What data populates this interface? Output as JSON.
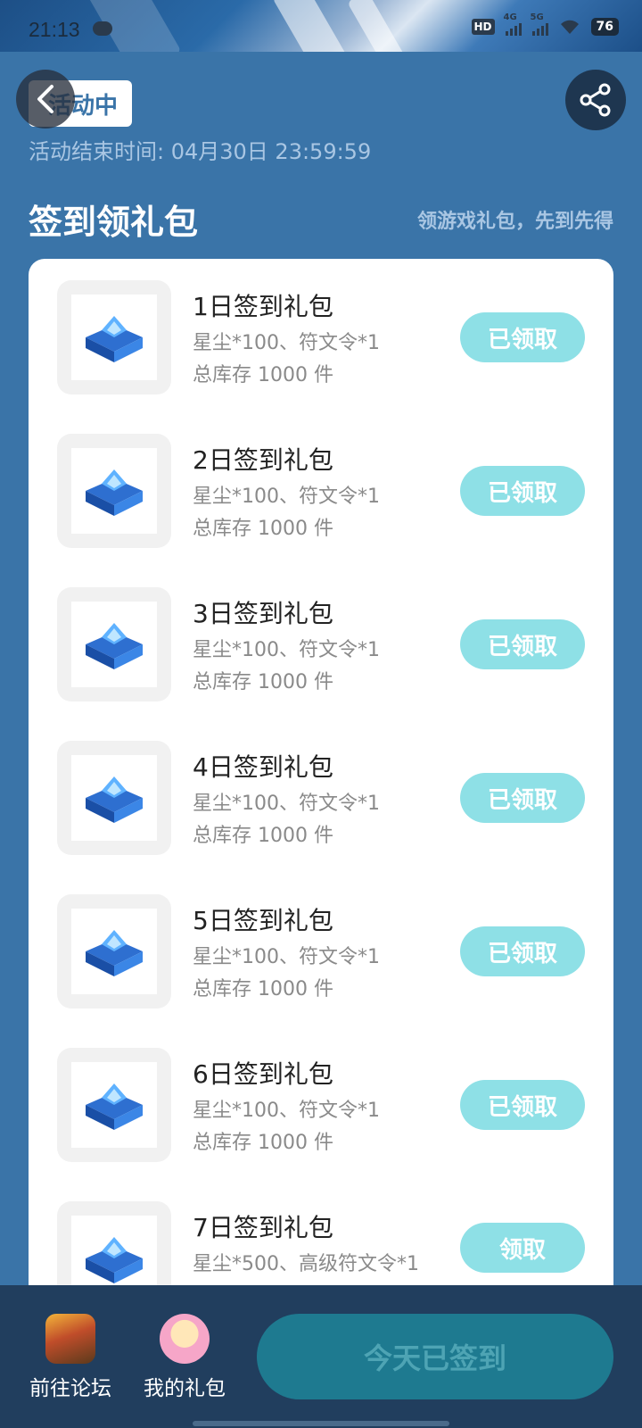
{
  "status_bar": {
    "time": "21:13",
    "battery": "76",
    "network_labels": [
      "4G",
      "5G"
    ],
    "hd_label": "HD"
  },
  "header": {
    "status_label": "活动中",
    "end_time": "活动结束时间: 04月30日 23:59:59"
  },
  "section": {
    "title": "签到领礼包",
    "subtitle": "领游戏礼包，先到先得"
  },
  "gifts": [
    {
      "title": "1日签到礼包",
      "desc": "星尘*100、符文令*1",
      "stock": "总库存 1000 件",
      "button": "已领取"
    },
    {
      "title": "2日签到礼包",
      "desc": "星尘*100、符文令*1",
      "stock": "总库存 1000 件",
      "button": "已领取"
    },
    {
      "title": "3日签到礼包",
      "desc": "星尘*100、符文令*1",
      "stock": "总库存 1000 件",
      "button": "已领取"
    },
    {
      "title": "4日签到礼包",
      "desc": "星尘*100、符文令*1",
      "stock": "总库存 1000 件",
      "button": "已领取"
    },
    {
      "title": "5日签到礼包",
      "desc": "星尘*100、符文令*1",
      "stock": "总库存 1000 件",
      "button": "已领取"
    },
    {
      "title": "6日签到礼包",
      "desc": "星尘*100、符文令*1",
      "stock": "总库存 1000 件",
      "button": "已领取"
    },
    {
      "title": "7日签到礼包",
      "desc": "星尘*500、高级符文令*1",
      "stock": "",
      "button": "领取"
    }
  ],
  "bottom_bar": {
    "forum_label": "前往论坛",
    "gifts_label": "我的礼包",
    "checkin_label": "今天已签到"
  },
  "colors": {
    "background": "#3a74a8",
    "claim_button": "#8ee0e6",
    "bottom_bar": "#213e5e",
    "checkin_button": "#1e7a90"
  },
  "icons": [
    "back-arrow-icon",
    "share-icon",
    "treasure-chest-icon",
    "forum-game-icon",
    "my-gifts-icon"
  ]
}
